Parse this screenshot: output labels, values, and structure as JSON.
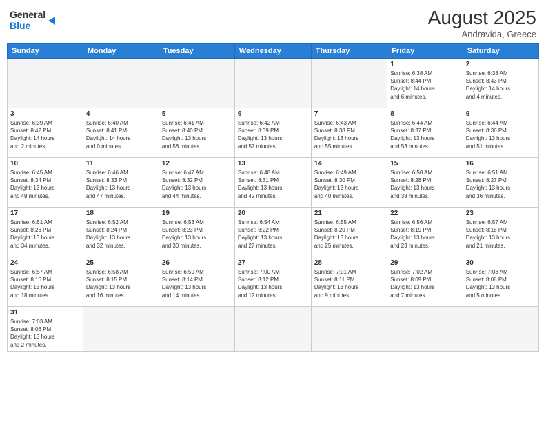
{
  "header": {
    "logo_general": "General",
    "logo_blue": "Blue",
    "month_year": "August 2025",
    "location": "Andravida, Greece"
  },
  "weekdays": [
    "Sunday",
    "Monday",
    "Tuesday",
    "Wednesday",
    "Thursday",
    "Friday",
    "Saturday"
  ],
  "weeks": [
    [
      {
        "day": "",
        "info": ""
      },
      {
        "day": "",
        "info": ""
      },
      {
        "day": "",
        "info": ""
      },
      {
        "day": "",
        "info": ""
      },
      {
        "day": "",
        "info": ""
      },
      {
        "day": "1",
        "info": "Sunrise: 6:38 AM\nSunset: 8:44 PM\nDaylight: 14 hours\nand 6 minutes."
      },
      {
        "day": "2",
        "info": "Sunrise: 6:38 AM\nSunset: 8:43 PM\nDaylight: 14 hours\nand 4 minutes."
      }
    ],
    [
      {
        "day": "3",
        "info": "Sunrise: 6:39 AM\nSunset: 8:42 PM\nDaylight: 14 hours\nand 2 minutes."
      },
      {
        "day": "4",
        "info": "Sunrise: 6:40 AM\nSunset: 8:41 PM\nDaylight: 14 hours\nand 0 minutes."
      },
      {
        "day": "5",
        "info": "Sunrise: 6:41 AM\nSunset: 8:40 PM\nDaylight: 13 hours\nand 58 minutes."
      },
      {
        "day": "6",
        "info": "Sunrise: 6:42 AM\nSunset: 8:39 PM\nDaylight: 13 hours\nand 57 minutes."
      },
      {
        "day": "7",
        "info": "Sunrise: 6:43 AM\nSunset: 8:38 PM\nDaylight: 13 hours\nand 55 minutes."
      },
      {
        "day": "8",
        "info": "Sunrise: 6:44 AM\nSunset: 8:37 PM\nDaylight: 13 hours\nand 53 minutes."
      },
      {
        "day": "9",
        "info": "Sunrise: 6:44 AM\nSunset: 8:36 PM\nDaylight: 13 hours\nand 51 minutes."
      }
    ],
    [
      {
        "day": "10",
        "info": "Sunrise: 6:45 AM\nSunset: 8:34 PM\nDaylight: 13 hours\nand 49 minutes."
      },
      {
        "day": "11",
        "info": "Sunrise: 6:46 AM\nSunset: 8:33 PM\nDaylight: 13 hours\nand 47 minutes."
      },
      {
        "day": "12",
        "info": "Sunrise: 6:47 AM\nSunset: 8:32 PM\nDaylight: 13 hours\nand 44 minutes."
      },
      {
        "day": "13",
        "info": "Sunrise: 6:48 AM\nSunset: 8:31 PM\nDaylight: 13 hours\nand 42 minutes."
      },
      {
        "day": "14",
        "info": "Sunrise: 6:49 AM\nSunset: 8:30 PM\nDaylight: 13 hours\nand 40 minutes."
      },
      {
        "day": "15",
        "info": "Sunrise: 6:50 AM\nSunset: 8:28 PM\nDaylight: 13 hours\nand 38 minutes."
      },
      {
        "day": "16",
        "info": "Sunrise: 6:51 AM\nSunset: 8:27 PM\nDaylight: 13 hours\nand 36 minutes."
      }
    ],
    [
      {
        "day": "17",
        "info": "Sunrise: 6:51 AM\nSunset: 8:26 PM\nDaylight: 13 hours\nand 34 minutes."
      },
      {
        "day": "18",
        "info": "Sunrise: 6:52 AM\nSunset: 8:24 PM\nDaylight: 13 hours\nand 32 minutes."
      },
      {
        "day": "19",
        "info": "Sunrise: 6:53 AM\nSunset: 8:23 PM\nDaylight: 13 hours\nand 30 minutes."
      },
      {
        "day": "20",
        "info": "Sunrise: 6:54 AM\nSunset: 8:22 PM\nDaylight: 13 hours\nand 27 minutes."
      },
      {
        "day": "21",
        "info": "Sunrise: 6:55 AM\nSunset: 8:20 PM\nDaylight: 13 hours\nand 25 minutes."
      },
      {
        "day": "22",
        "info": "Sunrise: 6:56 AM\nSunset: 8:19 PM\nDaylight: 13 hours\nand 23 minutes."
      },
      {
        "day": "23",
        "info": "Sunrise: 6:57 AM\nSunset: 8:18 PM\nDaylight: 13 hours\nand 21 minutes."
      }
    ],
    [
      {
        "day": "24",
        "info": "Sunrise: 6:57 AM\nSunset: 8:16 PM\nDaylight: 13 hours\nand 18 minutes."
      },
      {
        "day": "25",
        "info": "Sunrise: 6:58 AM\nSunset: 8:15 PM\nDaylight: 13 hours\nand 16 minutes."
      },
      {
        "day": "26",
        "info": "Sunrise: 6:59 AM\nSunset: 8:14 PM\nDaylight: 13 hours\nand 14 minutes."
      },
      {
        "day": "27",
        "info": "Sunrise: 7:00 AM\nSunset: 8:12 PM\nDaylight: 13 hours\nand 12 minutes."
      },
      {
        "day": "28",
        "info": "Sunrise: 7:01 AM\nSunset: 8:11 PM\nDaylight: 13 hours\nand 9 minutes."
      },
      {
        "day": "29",
        "info": "Sunrise: 7:02 AM\nSunset: 8:09 PM\nDaylight: 13 hours\nand 7 minutes."
      },
      {
        "day": "30",
        "info": "Sunrise: 7:03 AM\nSunset: 8:08 PM\nDaylight: 13 hours\nand 5 minutes."
      }
    ],
    [
      {
        "day": "31",
        "info": "Sunrise: 7:03 AM\nSunset: 8:06 PM\nDaylight: 13 hours\nand 2 minutes."
      },
      {
        "day": "",
        "info": ""
      },
      {
        "day": "",
        "info": ""
      },
      {
        "day": "",
        "info": ""
      },
      {
        "day": "",
        "info": ""
      },
      {
        "day": "",
        "info": ""
      },
      {
        "day": "",
        "info": ""
      }
    ]
  ]
}
